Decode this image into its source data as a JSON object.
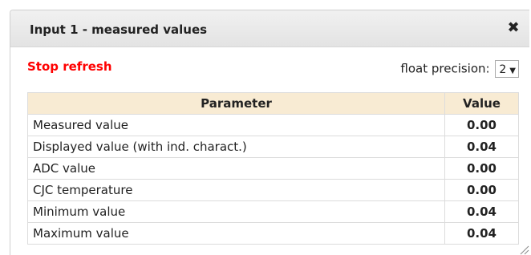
{
  "dialog": {
    "title": "Input 1 - measured values",
    "close_glyph": "✖",
    "stop_refresh": "Stop refresh",
    "precision_label": "float precision:",
    "precision_value": "2",
    "precision_arrow": "▼"
  },
  "table": {
    "headers": [
      "Parameter",
      "Value"
    ],
    "rows": [
      {
        "parameter": "Measured value",
        "value": "0.00"
      },
      {
        "parameter": "Displayed value (with ind. charact.)",
        "value": "0.04"
      },
      {
        "parameter": "ADC value",
        "value": "0.00"
      },
      {
        "parameter": "CJC temperature",
        "value": "0.00"
      },
      {
        "parameter": "Minimum value",
        "value": "0.04"
      },
      {
        "parameter": "Maximum value",
        "value": "0.04"
      }
    ]
  },
  "colors": {
    "stop_refresh": "#ff0000",
    "header_bg": "#f8ebd3"
  },
  "icons": {
    "close": "close-icon",
    "dropdown": "chevron-down-icon",
    "resize": "resize-grip-icon"
  }
}
